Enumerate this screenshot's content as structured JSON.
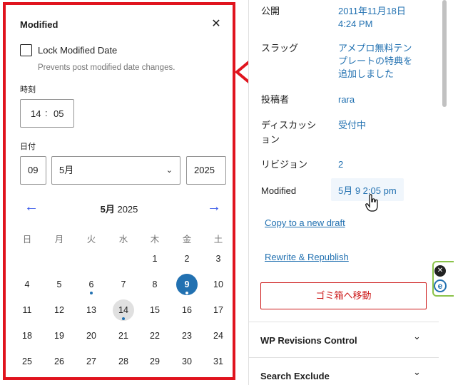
{
  "popover": {
    "title": "Modified",
    "close_icon": "✕",
    "lock_label": "Lock Modified Date",
    "lock_checked": false,
    "lock_help": "Prevents post modified date changes.",
    "time_label": "時刻",
    "hour": "14",
    "time_sep": ":",
    "minute": "05",
    "date_label": "日付",
    "day_value": "09",
    "month_value": "5月",
    "month_arrow": "⌄",
    "year_value": "2025",
    "prev_arrow": "←",
    "next_arrow": "→",
    "cal_month": "5月",
    "cal_year": "2025",
    "weekdays": [
      "日",
      "月",
      "火",
      "水",
      "木",
      "金",
      "土"
    ],
    "weeks": [
      [
        "",
        "",
        "",
        "",
        "1",
        "2",
        "3"
      ],
      [
        "4",
        "5",
        "6",
        "7",
        "8",
        "9",
        "10"
      ],
      [
        "11",
        "12",
        "13",
        "14",
        "15",
        "16",
        "17"
      ],
      [
        "18",
        "19",
        "20",
        "21",
        "22",
        "23",
        "24"
      ],
      [
        "25",
        "26",
        "27",
        "28",
        "29",
        "30",
        "31"
      ]
    ],
    "selected_day": "9",
    "today_day": "14",
    "dot_days": [
      "6",
      "9",
      "14"
    ]
  },
  "sidebar": {
    "publish_label": "公開",
    "publish_value_1": "2011年11月18日",
    "publish_value_2": "4:24 PM",
    "slug_label": "スラッグ",
    "slug_value_1": "アメプロ無料テン",
    "slug_value_2": "プレートの特典を",
    "slug_value_3": "追加しました",
    "author_label": "投稿者",
    "author_value": "rara",
    "discussion_label_1": "ディスカッシ",
    "discussion_label_2": "ョン",
    "discussion_value": "受付中",
    "revisions_label": "リビジョン",
    "revisions_value": "2",
    "modified_label": "Modified",
    "modified_value": "5月 9 2:05 pm",
    "copy_link": "Copy to a new draft",
    "rewrite_link": "Rewrite & Republish",
    "trash_button": "ゴミ箱へ移動",
    "panel_1": "WP Revisions Control",
    "panel_2": "Search Exclude",
    "chevron": "⌄"
  },
  "extension": {
    "close_glyph": "✕",
    "e_glyph": "e"
  },
  "colors": {
    "annotation": "#e0141e",
    "accent": "#2271b1",
    "danger": "#cc1818",
    "ext_border": "#8bc34a"
  }
}
